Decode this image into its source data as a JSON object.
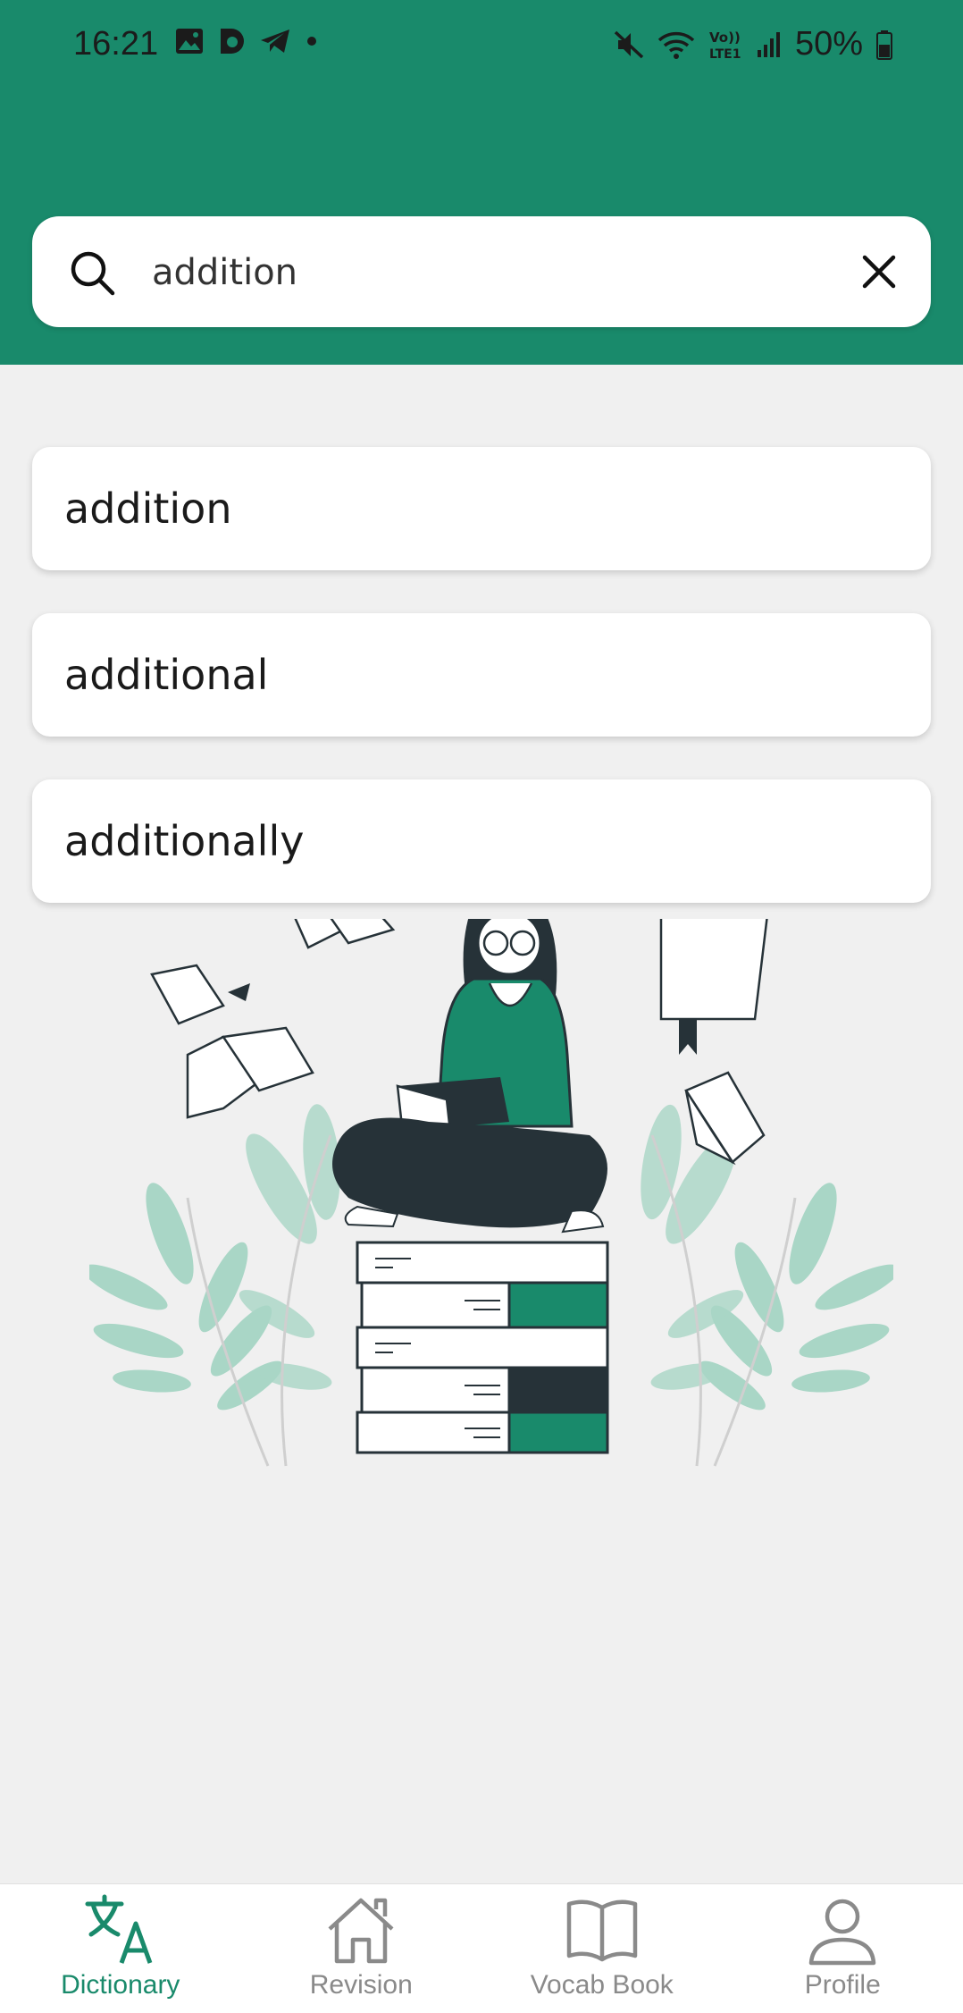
{
  "status_bar": {
    "time": "16:21",
    "battery": "50%",
    "left_icons": [
      "image-icon",
      "b-app-icon",
      "telegram-icon",
      "dot-icon"
    ],
    "right_icons": [
      "mute-icon",
      "wifi-icon",
      "volte-icon",
      "signal-icon",
      "battery-icon"
    ]
  },
  "search": {
    "value": "addition",
    "placeholder": ""
  },
  "suggestions": [
    "addition",
    "additional",
    "additionally"
  ],
  "bottom_nav": {
    "items": [
      {
        "label": "Dictionary",
        "icon": "translate-icon",
        "active": true
      },
      {
        "label": "Revision",
        "icon": "home-icon",
        "active": false
      },
      {
        "label": "Vocab Book",
        "icon": "book-icon",
        "active": false
      },
      {
        "label": "Profile",
        "icon": "person-icon",
        "active": false
      }
    ]
  },
  "colors": {
    "primary": "#198a6b",
    "background": "#f0f0f0",
    "inactive": "#8a8a8a"
  }
}
